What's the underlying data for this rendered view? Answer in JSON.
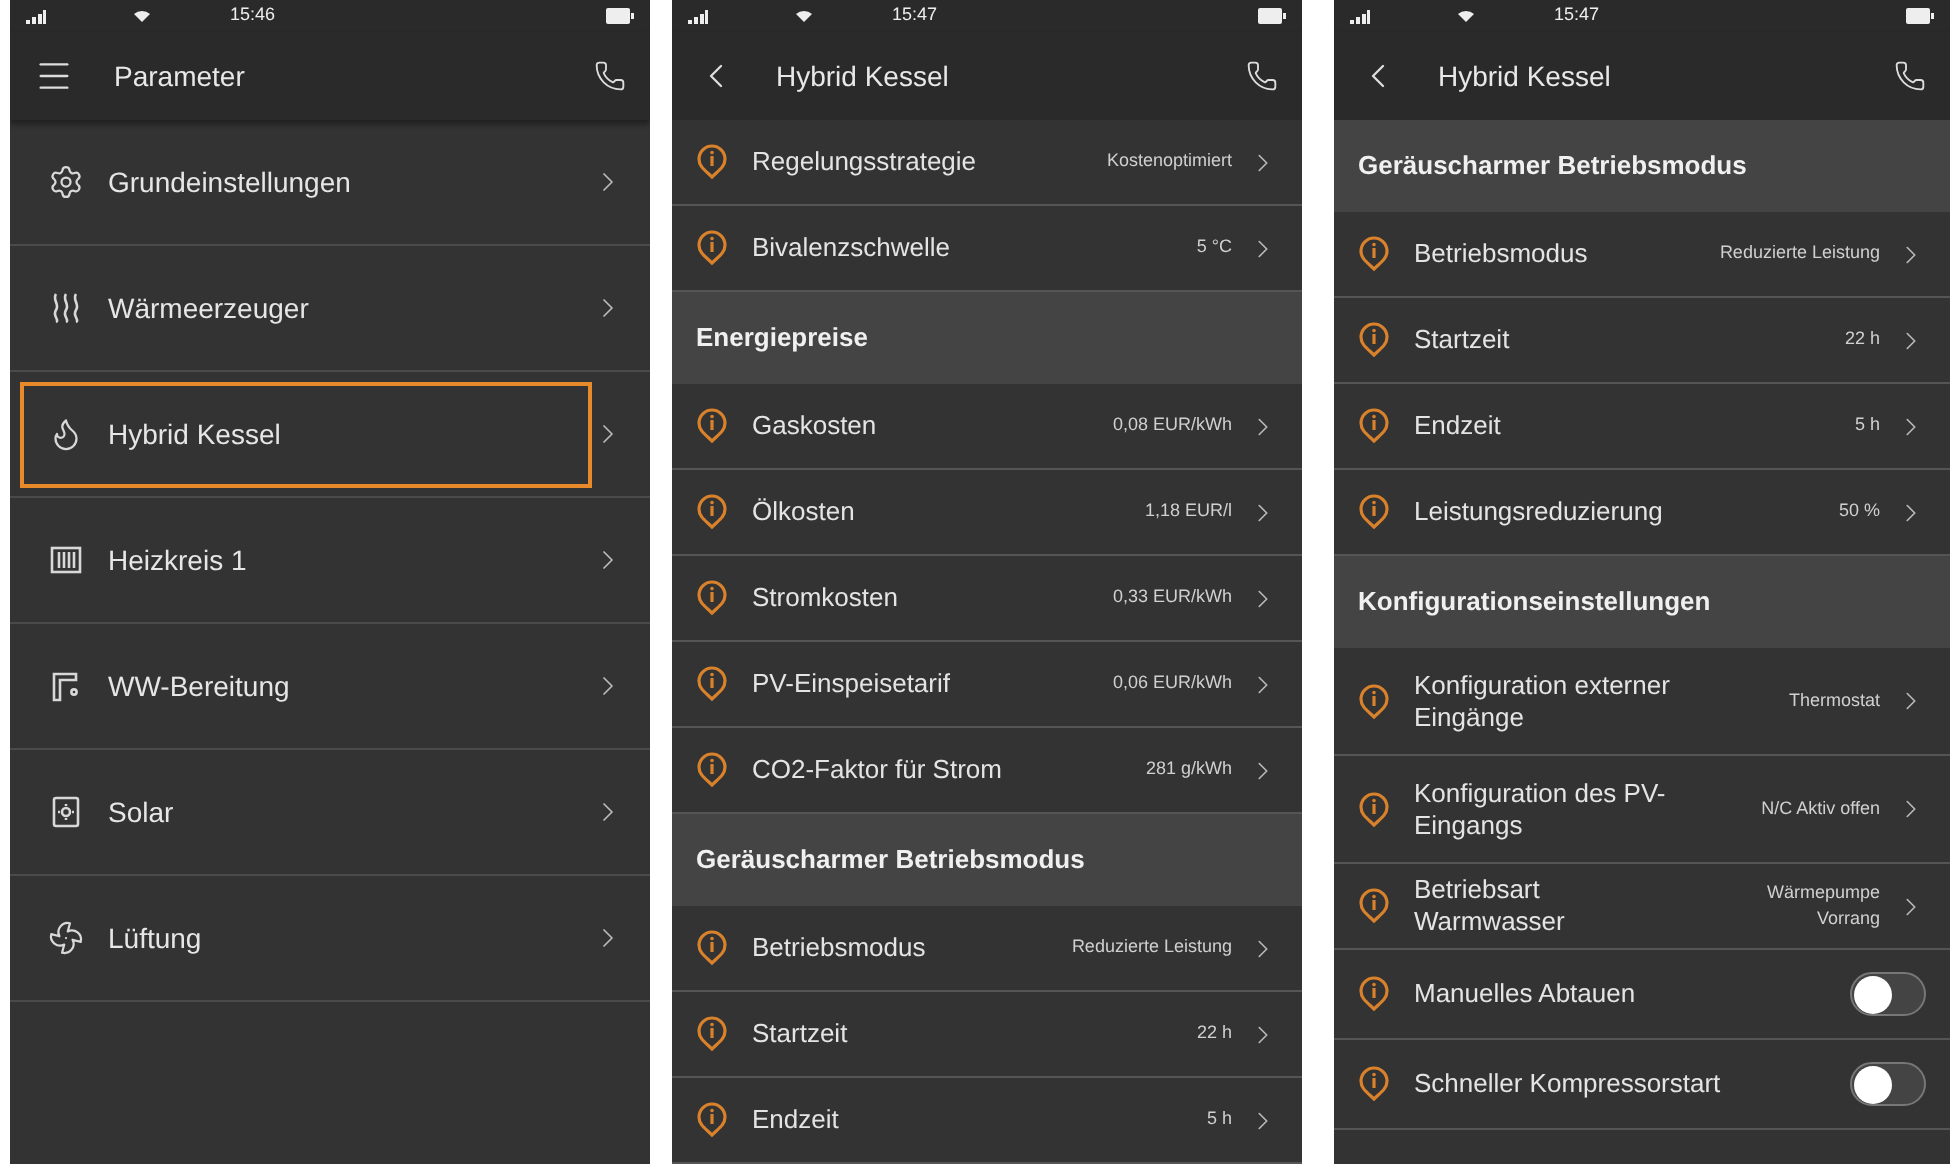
{
  "screens": [
    {
      "status": {
        "time": "15:46"
      },
      "header": {
        "kind": "menu",
        "title": "Parameter"
      },
      "items": [
        {
          "kind": "menu",
          "label": "Grundeinstellungen",
          "selected": false
        },
        {
          "kind": "menu",
          "label": "Wärmeerzeuger",
          "selected": false
        },
        {
          "kind": "menu",
          "label": "Hybrid Kessel",
          "selected": true
        },
        {
          "kind": "menu",
          "label": "Heizkreis 1",
          "selected": false
        },
        {
          "kind": "menu",
          "label": "WW-Bereitung",
          "selected": false
        },
        {
          "kind": "menu",
          "label": "Solar",
          "selected": false
        },
        {
          "kind": "menu",
          "label": "Lüftung",
          "selected": false
        }
      ]
    },
    {
      "status": {
        "time": "15:47"
      },
      "header": {
        "kind": "back",
        "title": "Hybrid Kessel"
      },
      "items": [
        {
          "kind": "setting",
          "label": "Regelungsstrategie",
          "value": "Kostenoptimiert"
        },
        {
          "kind": "setting",
          "label": "Bivalenzschwelle",
          "value": "5 °C"
        },
        {
          "kind": "section",
          "label": "Energiepreise"
        },
        {
          "kind": "setting",
          "label": "Gaskosten",
          "value": "0,08 EUR/kWh"
        },
        {
          "kind": "setting",
          "label": "Ölkosten",
          "value": "1,18 EUR/l"
        },
        {
          "kind": "setting",
          "label": "Stromkosten",
          "value": "0,33 EUR/kWh"
        },
        {
          "kind": "setting",
          "label": "PV-Einspeisetarif",
          "value": "0,06 EUR/kWh"
        },
        {
          "kind": "setting",
          "label": "CO2-Faktor für Strom",
          "value": "281 g/kWh"
        },
        {
          "kind": "section",
          "label": "Geräuscharmer Betriebsmodus"
        },
        {
          "kind": "setting",
          "label": "Betriebsmodus",
          "value": "Reduzierte Leistung"
        },
        {
          "kind": "setting",
          "label": "Startzeit",
          "value": "22 h"
        },
        {
          "kind": "setting",
          "label": "Endzeit",
          "value": "5 h"
        }
      ]
    },
    {
      "status": {
        "time": "15:47"
      },
      "header": {
        "kind": "back",
        "title": "Hybrid Kessel"
      },
      "items": [
        {
          "kind": "section",
          "label": "Geräuscharmer Betriebsmodus"
        },
        {
          "kind": "setting",
          "label": "Betriebsmodus",
          "value": "Reduzierte Leistung"
        },
        {
          "kind": "setting",
          "label": "Startzeit",
          "value": "22 h"
        },
        {
          "kind": "setting",
          "label": "Endzeit",
          "value": "5 h"
        },
        {
          "kind": "setting",
          "label": "Leistungsreduzierung",
          "value": "50 %"
        },
        {
          "kind": "section",
          "label": "Konfigurationseinstellungen"
        },
        {
          "kind": "setting",
          "label": "Konfiguration externer Eingänge",
          "value": "Thermostat"
        },
        {
          "kind": "setting",
          "label": "Konfiguration des PV-Eingangs",
          "value": "N/C Aktiv offen"
        },
        {
          "kind": "setting",
          "label": "Betriebsart Warmwasser",
          "value": "Wärmepumpe Vorrang"
        },
        {
          "kind": "toggle",
          "label": "Manuelles Abtauen",
          "on": false
        },
        {
          "kind": "toggle",
          "label": "Schneller Kompressorstart",
          "on": false
        }
      ]
    }
  ]
}
